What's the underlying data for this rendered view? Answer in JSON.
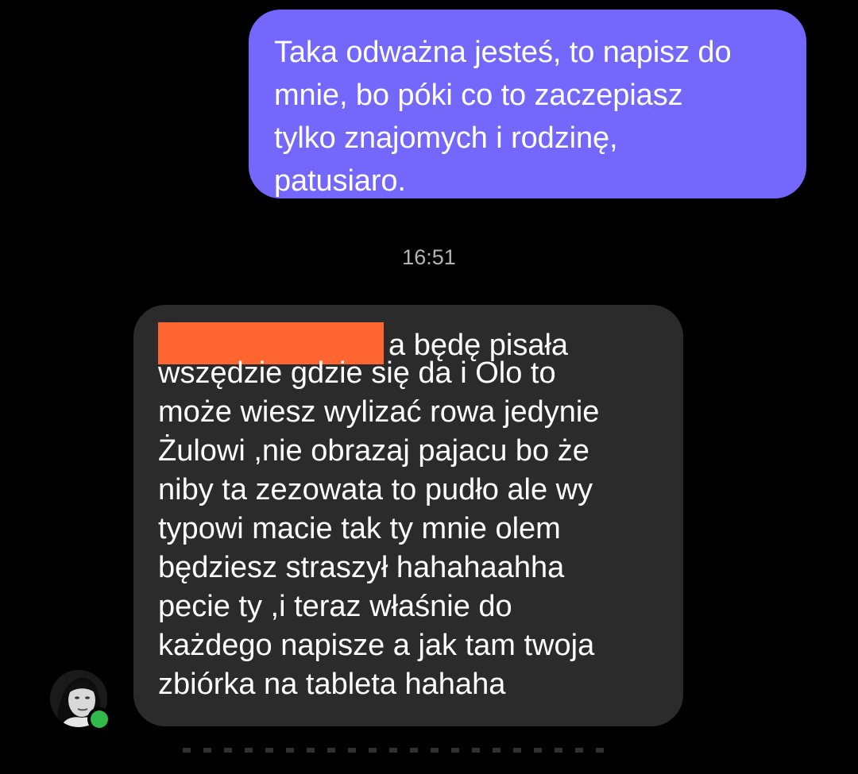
{
  "outgoing_message": {
    "text": "Taka odważna jesteś, to napisz do\nmnie, bo póki co to zaczepiasz\ntylko znajomych i rodzinę,\npatusiaro."
  },
  "timestamp": "16:51",
  "incoming_message": {
    "first_line": "a będę pisała",
    "text": "wszędzie gdzie się da i Olo to\nmoże wiesz wylizać rowa jedynie\nŻulowi ,nie obrazaj pajacu bo że\nniby ta zezowata to pudło ale wy\ntypowi macie tak ty mnie olem\nbędziesz straszył hahahaahha\npecie ty ,i teraz właśnie do\nkażdego napisze a jak tam twoja\nzbiórka na tableta hahaha",
    "redaction_color": "#ff6530"
  },
  "colors": {
    "background": "#000000",
    "outgoing_bubble": "#7467fb",
    "incoming_bubble": "#2b2b2b",
    "online_indicator": "#31b94b"
  },
  "avatar": {
    "icon": "profile-photo",
    "status_icon": "online-dot-icon"
  }
}
